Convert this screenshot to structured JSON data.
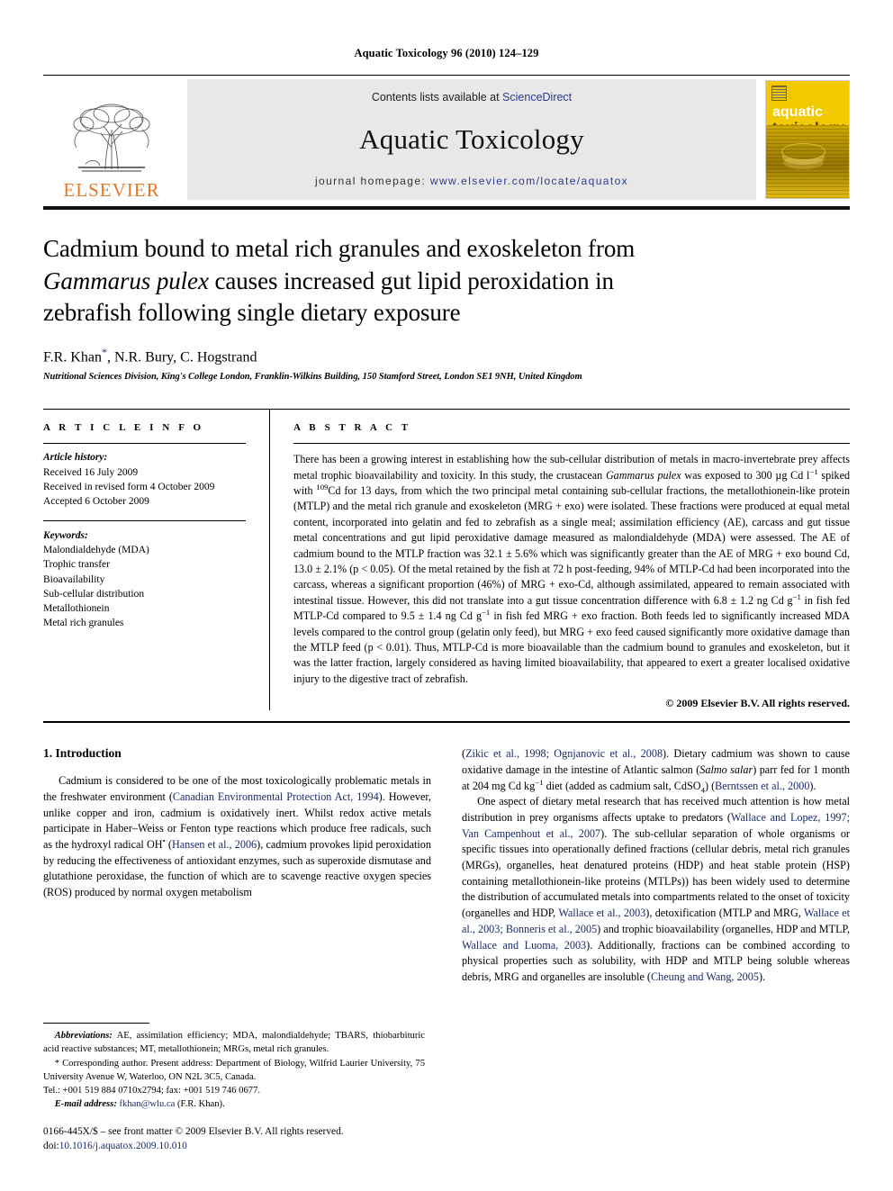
{
  "running_head": "Aquatic Toxicology 96 (2010) 124–129",
  "masthead": {
    "publisher_name": "ELSEVIER",
    "contents_prefix": "Contents lists available at ",
    "contents_link": "ScienceDirect",
    "journal_title": "Aquatic Toxicology",
    "homepage_prefix": "journal homepage: ",
    "homepage_url": "www.elsevier.com/locate/aquatox",
    "cover_word_1": "aquatic",
    "cover_word_2": "toxicology",
    "link_color": "#2b3a8f",
    "cover_color": "#f2c800",
    "elsevier_orange": "#E87722"
  },
  "title": {
    "line1": "Cadmium bound to metal rich granules and exoskeleton from",
    "species": "Gammarus pulex",
    "line2_rest": " causes increased gut lipid peroxidation in",
    "line3": "zebrafish following single dietary exposure"
  },
  "authors": {
    "names_before_star": "F.R. Khan",
    "star": "*",
    "names_after_star": ", N.R. Bury, C. Hogstrand",
    "affiliation": "Nutritional Sciences Division, King's College London, Franklin-Wilkins Building, 150 Stamford Street, London SE1 9NH, United Kingdom"
  },
  "article_info": {
    "heading": "A R T I C L E   I N F O",
    "history_label": "Article history:",
    "history": [
      "Received 16 July 2009",
      "Received in revised form 4 October 2009",
      "Accepted 6 October 2009"
    ],
    "keywords_label": "Keywords:",
    "keywords": [
      "Malondialdehyde (MDA)",
      "Trophic transfer",
      "Bioavailability",
      "Sub-cellular distribution",
      "Metallothionein",
      "Metal rich granules"
    ]
  },
  "abstract": {
    "heading": "A B S T R A C T",
    "part1": "There has been a growing interest in establishing how the sub-cellular distribution of metals in macro-invertebrate prey affects metal trophic bioavailability and toxicity. In this study, the crustacean ",
    "species1": "Gammarus pulex",
    "part2": " was exposed to 300 µg Cd l",
    "sup1": "−1",
    "part3": " spiked with ",
    "sup2": "109",
    "part4": "Cd for 13 days, from which the two principal metal containing sub-cellular fractions, the metallothionein-like protein (MTLP) and the metal rich granule and exoskeleton (MRG + exo) were isolated. These fractions were produced at equal metal content, incorporated into gelatin and fed to zebrafish as a single meal; assimilation efficiency (AE), carcass and gut tissue metal concentrations and gut lipid peroxidative damage measured as malondialdehyde (MDA) were assessed. The AE of cadmium bound to the MTLP fraction was 32.1 ± 5.6% which was significantly greater than the AE of MRG + exo bound Cd, 13.0 ± 2.1% (p < 0.05). Of the metal retained by the fish at 72 h post-feeding, 94% of MTLP-Cd had been incorporated into the carcass, whereas a significant proportion (46%) of MRG + exo-Cd, although assimilated, appeared to remain associated with intestinal tissue. However, this did not translate into a gut tissue concentration difference with 6.8 ± 1.2 ng Cd g",
    "sup3": "−1",
    "part5": " in fish fed MTLP-Cd compared to 9.5 ± 1.4 ng Cd g",
    "sup4": "−1",
    "part6": " in fish fed MRG + exo fraction. Both feeds led to significantly increased MDA levels compared to the control group (gelatin only feed), but MRG + exo feed caused significantly more oxidative damage than the MTLP feed (p < 0.01). Thus, MTLP-Cd is more bioavailable than the cadmium bound to granules and exoskeleton, but it was the latter fraction, largely considered as having limited bioavailability, that appeared to exert a greater localised oxidative injury to the digestive tract of zebrafish.",
    "copyright": "© 2009 Elsevier B.V. All rights reserved."
  },
  "introduction": {
    "heading": "1.  Introduction",
    "left_p1_a": "Cadmium is considered to be one of the most toxicologically problematic metals in the freshwater environment (",
    "left_cite1": "Canadian Environmental Protection Act, 1994",
    "left_p1_b": "). However, unlike copper and iron, cadmium is oxidatively inert. Whilst redox active metals participate in Haber–Weiss or Fenton type reactions which produce free radicals, such as the hydroxyl radical OH",
    "left_radical_dot": "•",
    "left_p1_c": " (",
    "left_cite2": "Hansen et al., 2006",
    "left_p1_d": "), cadmium provokes lipid peroxidation by reducing the effectiveness of antioxidant enzymes, such as superoxide dismutase and glutathione peroxidase, the function of which are to scavenge reactive oxygen species (ROS) produced by normal oxygen metabolism",
    "right_p1_a": "(",
    "right_cite1": "Zikic et al., 1998; Ognjanovic et al., 2008",
    "right_p1_b": "). Dietary cadmium was shown to cause oxidative damage in the intestine of Atlantic salmon (",
    "right_species1": "Salmo salar",
    "right_p1_c": ") parr fed for 1 month at 204 mg Cd kg",
    "right_sup1": "−1",
    "right_p1_d": " diet (added as cadmium salt, CdSO",
    "right_sub1": "4",
    "right_p1_e": ") (",
    "right_cite2": "Berntssen et al., 2000",
    "right_p1_f": ").",
    "right_p2_a": "One aspect of dietary metal research that has received much attention is how metal distribution in prey organisms affects uptake to predators (",
    "right_cite3": "Wallace and Lopez, 1997; Van Campenhout et al., 2007",
    "right_p2_b": "). The sub-cellular separation of whole organisms or specific tissues into operationally defined fractions (cellular debris, metal rich granules (MRGs), organelles, heat denatured proteins (HDP) and heat stable protein (HSP) containing metallothionein-like proteins (MTLPs)) has been widely used to determine the distribution of accumulated metals into compartments related to the onset of toxicity (organelles and HDP, ",
    "right_cite4": "Wallace et al., 2003",
    "right_p2_c": "), detoxification (MTLP and MRG, ",
    "right_cite5": "Wallace et al., 2003; Bonneris et al., 2005",
    "right_p2_d": ") and trophic bioavailability (organelles, HDP and MTLP, ",
    "right_cite6": "Wallace and Luoma, 2003",
    "right_p2_e": "). Additionally, fractions can be combined according to physical properties such as solubility, with HDP and MTLP being soluble whereas debris, MRG and organelles are insoluble (",
    "right_cite7": "Cheung and Wang, 2005",
    "right_p2_f": ")."
  },
  "footnotes": {
    "abbrev_label": "Abbreviations:",
    "abbrev_text": " AE, assimilation efficiency; MDA, malondialdehyde; TBARS, thiobarbituric acid reactive substances; MT, metallothionein; MRGs, metal rich granules.",
    "corr_star": "*",
    "corr_text": " Corresponding author. Present address: Department of Biology, Wilfrid Laurier University, 75 University Avenue W, Waterloo, ON N2L 3C5, Canada.",
    "tel_text": "Tel.: +001 519 884 0710x2794; fax: +001 519 746 0677.",
    "email_label": "E-mail address:",
    "email_link": "fkhan@wlu.ca",
    "email_suffix": " (F.R. Khan).",
    "issn_line": "0166-445X/$ – see front matter © 2009 Elsevier B.V. All rights reserved.",
    "doi_label": "doi:",
    "doi_value": "10.1016/j.aquatox.2009.10.010"
  }
}
